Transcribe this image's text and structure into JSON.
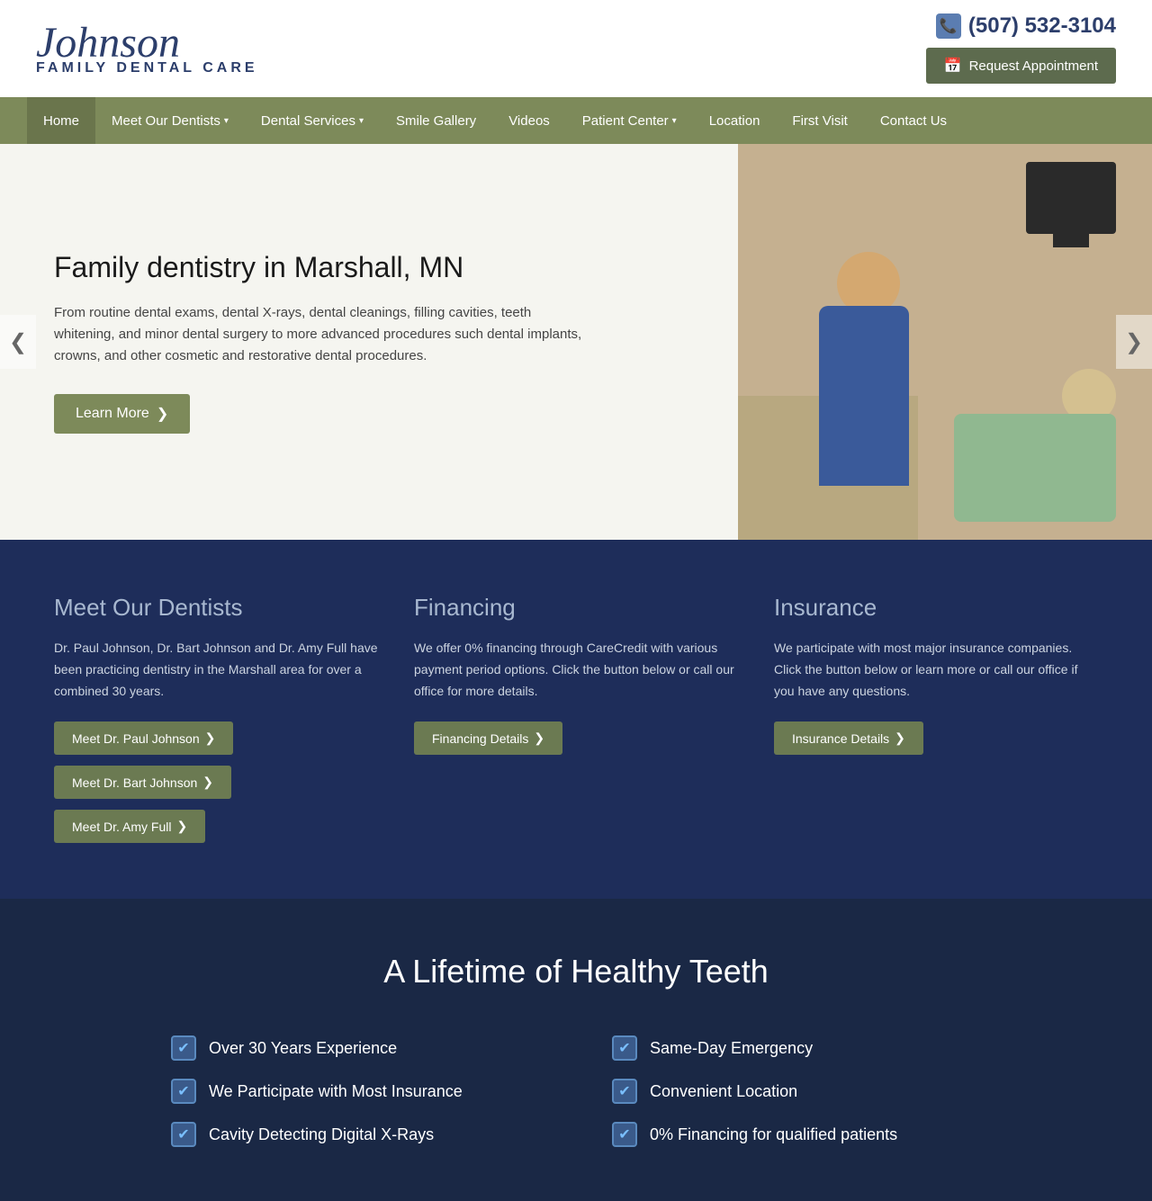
{
  "header": {
    "logo_script": "Johnson",
    "logo_sub": "FAMILY DENTAL CARE",
    "phone": "(507) 532-3104",
    "request_btn": "Request Appointment"
  },
  "nav": {
    "items": [
      {
        "label": "Home",
        "has_dropdown": false
      },
      {
        "label": "Meet Our Dentists",
        "has_dropdown": true
      },
      {
        "label": "Dental Services",
        "has_dropdown": true
      },
      {
        "label": "Smile Gallery",
        "has_dropdown": false
      },
      {
        "label": "Videos",
        "has_dropdown": false
      },
      {
        "label": "Patient Center",
        "has_dropdown": true
      },
      {
        "label": "Location",
        "has_dropdown": false
      },
      {
        "label": "First Visit",
        "has_dropdown": false
      },
      {
        "label": "Contact Us",
        "has_dropdown": false
      }
    ]
  },
  "hero": {
    "title": "Family dentistry in Marshall, MN",
    "description": "From routine dental exams, dental X-rays, dental cleanings, filling cavities, teeth whitening, and minor dental surgery to more advanced procedures such dental implants, crowns, and other cosmetic and restorative dental procedures.",
    "learn_more_btn": "Learn More",
    "prev_arrow": "❮",
    "next_arrow": "❯"
  },
  "features": {
    "dentists": {
      "title": "Meet Our Dentists",
      "description": "Dr. Paul Johnson, Dr. Bart Johnson and Dr. Amy Full have been practicing dentistry in the Marshall area for over a combined 30 years.",
      "buttons": [
        {
          "label": "Meet Dr. Paul Johnson"
        },
        {
          "label": "Meet Dr. Bart Johnson"
        },
        {
          "label": "Meet Dr. Amy Full"
        }
      ]
    },
    "financing": {
      "title": "Financing",
      "description": "We offer 0% financing through CareCredit with various payment period options. Click the button below or call our office for more details.",
      "button": "Financing Details"
    },
    "insurance": {
      "title": "Insurance",
      "description": "We participate with most major insurance companies. Click the button below or learn more or call our office if you have any questions.",
      "button": "Insurance Details"
    }
  },
  "lifetime": {
    "title": "A Lifetime of Healthy Teeth",
    "features": [
      {
        "label": "Over 30 Years Experience"
      },
      {
        "label": "Same-Day Emergency"
      },
      {
        "label": "We Participate with Most Insurance"
      },
      {
        "label": "Convenient Location"
      },
      {
        "label": "Cavity Detecting Digital X-Rays"
      },
      {
        "label": "0% Financing for qualified patients"
      }
    ]
  },
  "icons": {
    "phone": "📞",
    "calendar": "📅",
    "check": "✔",
    "arrow": "❯"
  }
}
